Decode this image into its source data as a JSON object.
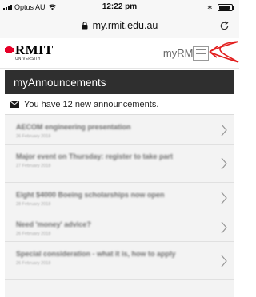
{
  "status_bar": {
    "carrier": "Optus AU",
    "time": "12:22 pm"
  },
  "browser": {
    "url": "my.rmit.edu.au"
  },
  "header": {
    "logo_main": "RMIT",
    "logo_sub": "UNIVERSITY",
    "site_name": "myRMIT"
  },
  "announcements": {
    "heading": "myAnnouncements",
    "summary": "You have 12 new announcements.",
    "items": [
      {
        "title": "AECOM engineering presentation",
        "date": "26 February 2018"
      },
      {
        "title": "Major event on Thursday: register to take part",
        "date": "27 February 2018"
      },
      {
        "title": "Eight $4000 Boeing scholarships now open",
        "date": "28 February 2018"
      },
      {
        "title": "Need 'money' advice?",
        "date": "26 February 2018"
      },
      {
        "title": "Special consideration - what it is, how to apply",
        "date": "26 February 2018"
      }
    ]
  },
  "colors": {
    "rmit_red": "#e60028",
    "annotation_red": "#e21b1b",
    "panel_header": "#2f2f2f"
  }
}
